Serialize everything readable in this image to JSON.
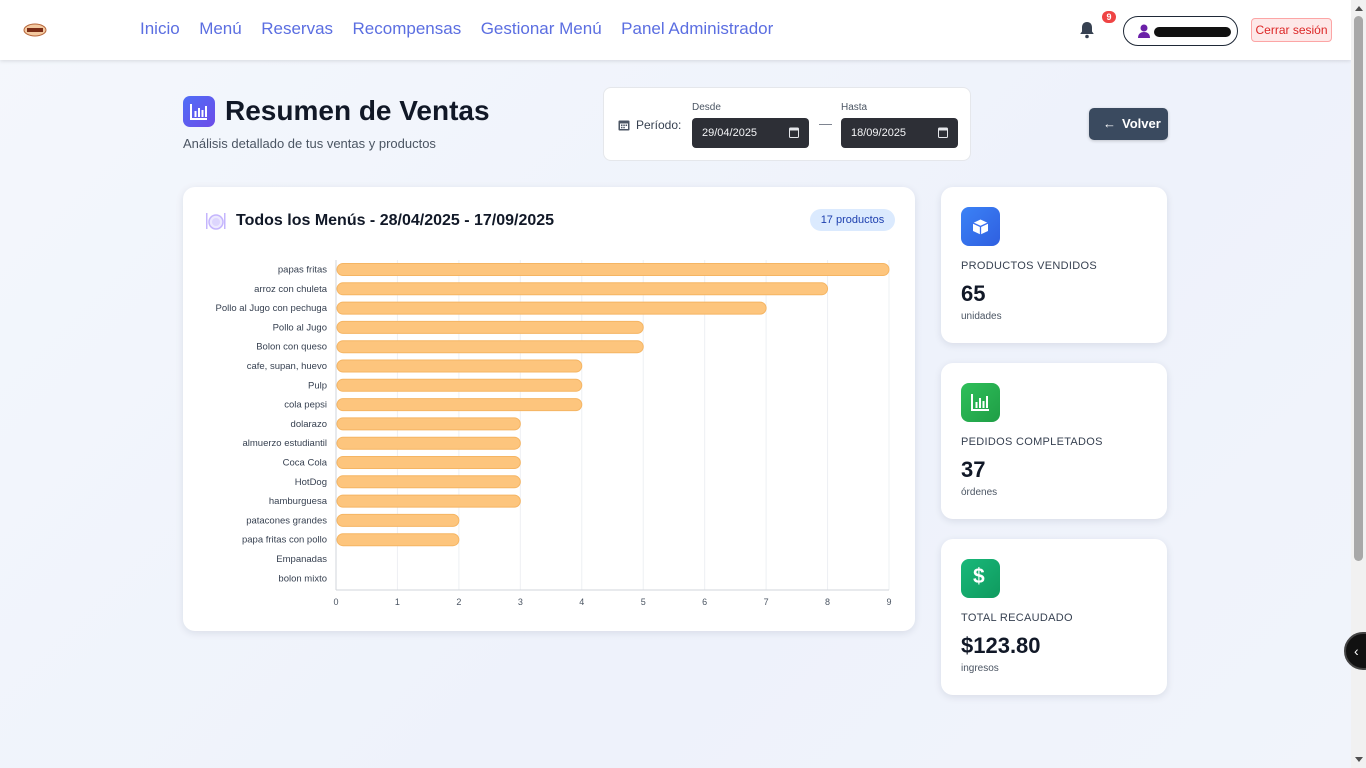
{
  "nav": {
    "links": [
      "Inicio",
      "Menú",
      "Reservas",
      "Recompensas",
      "Gestionar Menú",
      "Panel Administrador"
    ],
    "notification_count": "9",
    "logout_label": "Cerrar sesión"
  },
  "header": {
    "title": "Resumen de Ventas",
    "subtitle": "Análisis detallado de tus ventas y productos",
    "period_label": "Período:",
    "from_caption": "Desde",
    "from_value": "29/04/2025",
    "to_caption": "Hasta",
    "to_value": "18/09/2025",
    "back_label": "Volver"
  },
  "chart_card": {
    "title": "Todos los Menús - 28/04/2025 - 17/09/2025",
    "badge": "17 productos"
  },
  "chart_data": {
    "type": "bar",
    "orientation": "horizontal",
    "categories": [
      "papas fritas",
      "arroz con chuleta",
      "Pollo al Jugo con pechuga",
      "Pollo al Jugo",
      "Bolon con queso",
      "cafe, supan, huevo",
      "Pulp",
      "cola pepsi",
      "dolarazo",
      "almuerzo estudiantil",
      "Coca Cola",
      "HotDog",
      "hamburguesa",
      "patacones grandes",
      "papa fritas con pollo",
      "Empanadas",
      "bolon mixto"
    ],
    "values": [
      9,
      8,
      7,
      5,
      5,
      4,
      4,
      4,
      3,
      3,
      3,
      3,
      3,
      2,
      2,
      0,
      0
    ],
    "xlim": [
      0,
      9
    ],
    "xticks": [
      "0",
      "1",
      "2",
      "3",
      "4",
      "5",
      "6",
      "7",
      "8",
      "9"
    ],
    "grid": true,
    "bar_color": "#fdc57d",
    "bar_border": "#f5b563"
  },
  "stats": [
    {
      "label": "PRODUCTOS VENDIDOS",
      "value": "65",
      "sub": "unidades",
      "color": "#3b6ef0",
      "icon": "box-icon"
    },
    {
      "label": "PEDIDOS COMPLETADOS",
      "value": "37",
      "sub": "órdenes",
      "color": "#22b14c",
      "icon": "chart-icon"
    },
    {
      "label": "TOTAL RECAUDADO",
      "value": "$123.80",
      "sub": "ingresos",
      "color": "#14a86b",
      "icon": "dollar-icon"
    }
  ]
}
